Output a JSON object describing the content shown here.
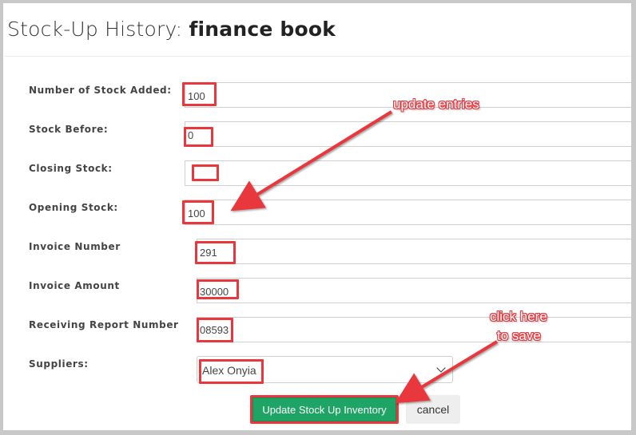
{
  "page": {
    "title_prefix": "Stock-Up History:",
    "title_book": "finance book"
  },
  "form": {
    "fields": [
      {
        "label": "Number of Stock Added:",
        "value": "100"
      },
      {
        "label": "Stock Before:",
        "value": "0"
      },
      {
        "label": "Closing Stock:",
        "value": ""
      },
      {
        "label": "Opening Stock:",
        "value": "100"
      },
      {
        "label": "Invoice Number",
        "value": "291"
      },
      {
        "label": "Invoice Amount",
        "value": "30000"
      },
      {
        "label": "Receiving Report Number",
        "value": "08593"
      }
    ],
    "suppliers": {
      "label": "Suppliers:",
      "selected": "Alex Onyia"
    },
    "submit_label": "Update Stock Up Inventory",
    "cancel_label": "cancel"
  },
  "annotations": {
    "update_entries": "update entries",
    "click_here_1": "click here",
    "click_here_2": "to save",
    "accent_color": "#e8383e"
  }
}
